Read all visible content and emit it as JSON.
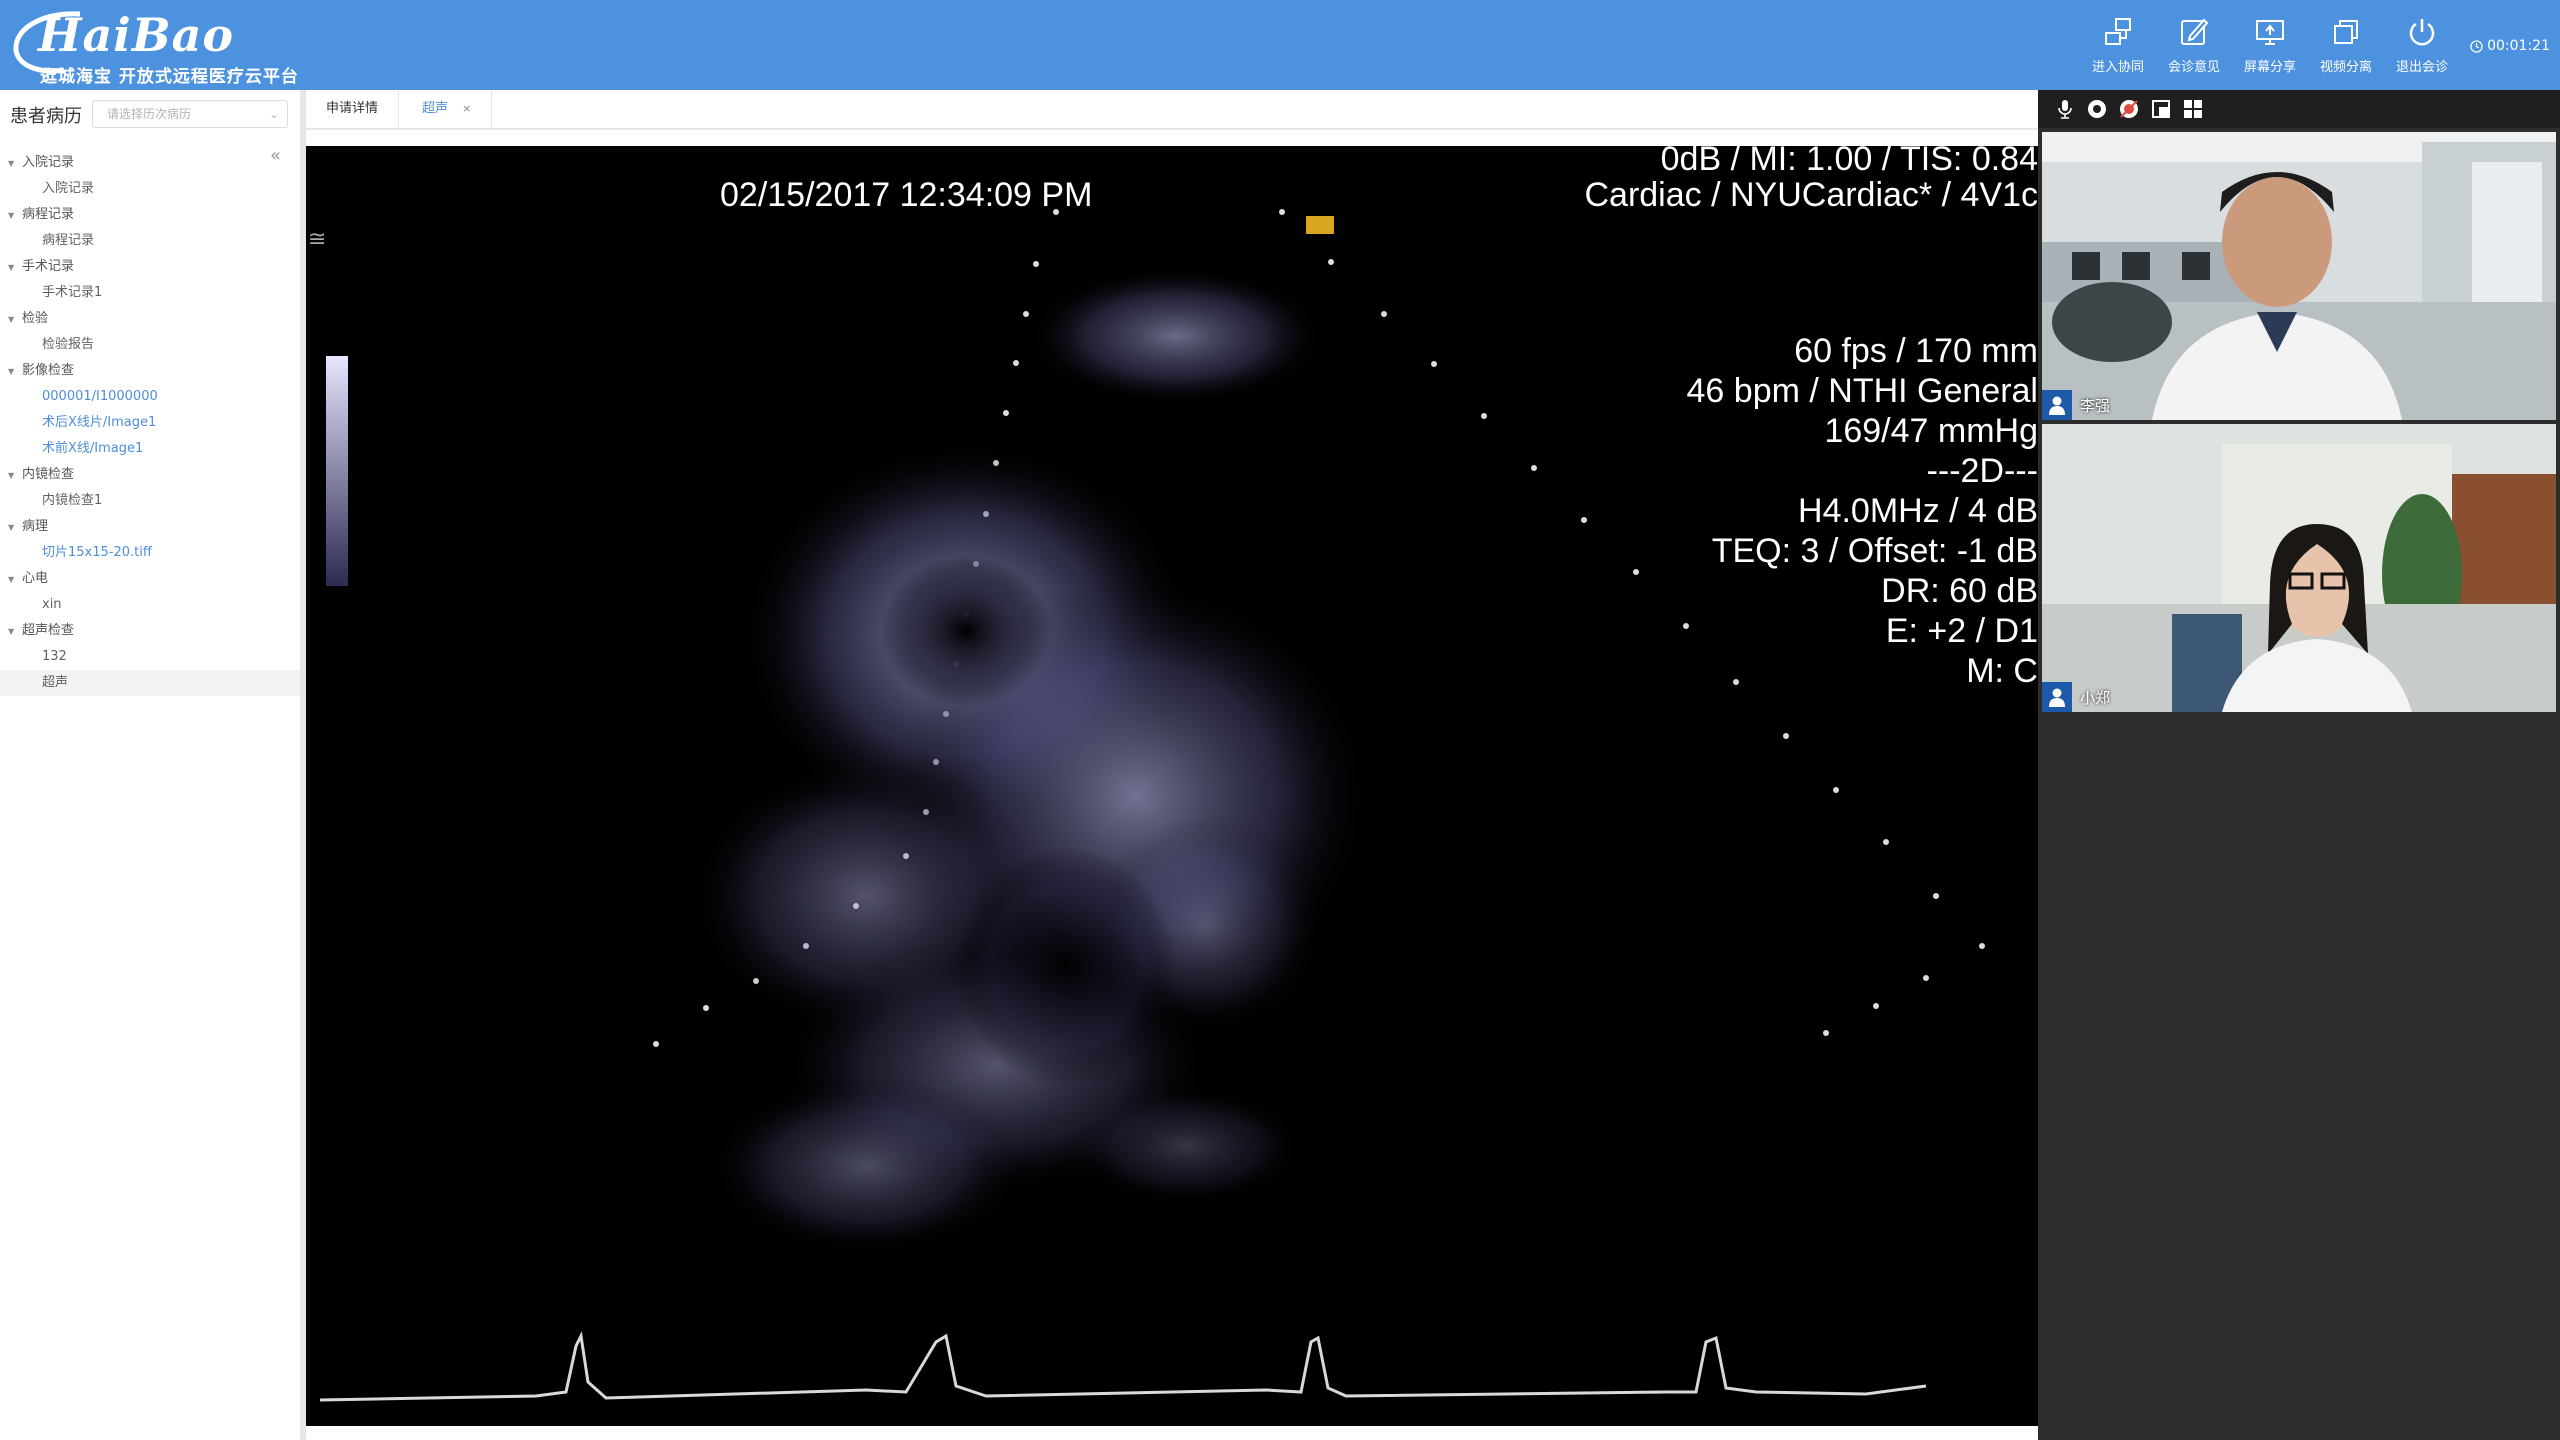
{
  "header": {
    "logo_text": "HaiBao",
    "logo_tagline": "逛城海宝 开放式远程医疗云平台",
    "tools": [
      {
        "label": "进入协同",
        "icon": "collaborate-icon"
      },
      {
        "label": "会诊意见",
        "icon": "edit-opinion-icon"
      },
      {
        "label": "屏幕分享",
        "icon": "screen-share-icon"
      },
      {
        "label": "视频分离",
        "icon": "video-separate-icon"
      },
      {
        "label": "退出会诊",
        "icon": "power-icon"
      }
    ],
    "timer": "00:01:21",
    "colors": {
      "bar": "#4d92de"
    }
  },
  "left_panel": {
    "title": "患者病历",
    "select_placeholder": "请选择历次病历",
    "tree": [
      {
        "label": "入院记录",
        "children": [
          {
            "label": "入院记录"
          }
        ]
      },
      {
        "label": "病程记录",
        "children": [
          {
            "label": "病程记录"
          }
        ]
      },
      {
        "label": "手术记录",
        "children": [
          {
            "label": "手术记录1"
          }
        ]
      },
      {
        "label": "检验",
        "children": [
          {
            "label": "检验报告"
          }
        ]
      },
      {
        "label": "影像检查",
        "children": [
          {
            "label": "000001/I1000000",
            "link": true
          },
          {
            "label": "术后X线片/Image1",
            "link": true
          },
          {
            "label": "术前X线/Image1",
            "link": true
          }
        ]
      },
      {
        "label": "内镜检查",
        "children": [
          {
            "label": "内镜检查1"
          }
        ]
      },
      {
        "label": "病理",
        "children": [
          {
            "label": "切片15x15-20.tiff",
            "link": true
          }
        ]
      },
      {
        "label": "心电",
        "children": [
          {
            "label": "xin"
          }
        ]
      },
      {
        "label": "超声检查",
        "children": [
          {
            "label": "132"
          },
          {
            "label": "超声",
            "active": true
          }
        ]
      }
    ]
  },
  "tabs": [
    {
      "label": "申请详情",
      "active": false,
      "closable": false
    },
    {
      "label": "超声",
      "active": true,
      "closable": true,
      "close": "×"
    }
  ],
  "viewer": {
    "date": "02/15/2017 12:34:09 PM",
    "info_lines": [
      "0dB / MI: 1.00 / TIS: 0.84",
      "Cardiac / NYUCardiac* / 4V1c",
      "60 fps / 170 mm",
      "46 bpm / NTHI General",
      "169/47 mmHg",
      "---2D---",
      "H4.0MHz / 4 dB",
      "TEQ: 3 / Offset: -1 dB",
      "DR: 60 dB",
      "E: +2 / D1",
      "M: C"
    ]
  },
  "right_panel": {
    "controls": [
      "microphone-icon",
      "camera-icon",
      "record-icon",
      "fullscreen-icon",
      "grid-icon"
    ],
    "participants": [
      {
        "name": "李强"
      },
      {
        "name": "小郑"
      }
    ]
  }
}
